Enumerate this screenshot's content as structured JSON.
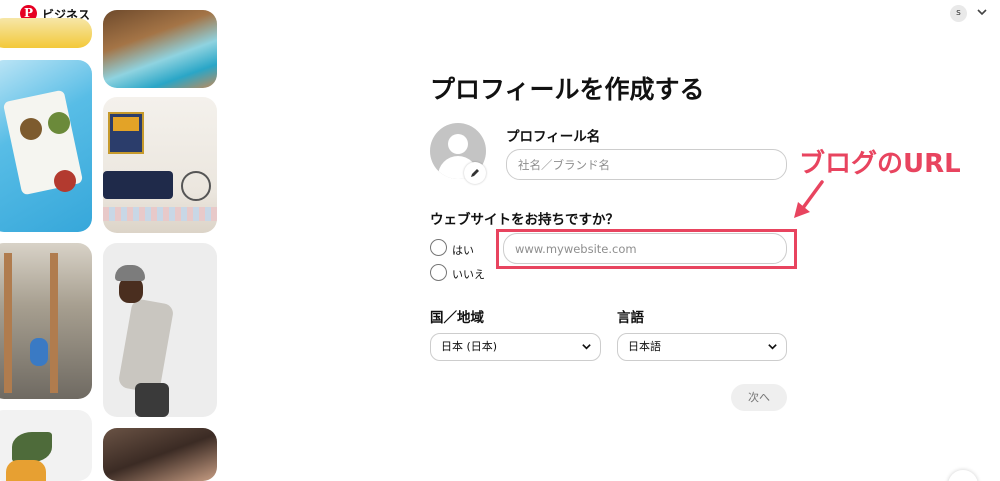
{
  "header": {
    "logo_glyph": "P",
    "brand": "ビジネス",
    "account_initial": "s"
  },
  "form": {
    "title": "プロフィールを作成する",
    "profile_name_label": "プロフィール名",
    "profile_name_placeholder": "社名／ブランド名",
    "website_question": "ウェブサイトをお持ちですか？",
    "option_yes": "はい",
    "option_no": "いいえ",
    "website_placeholder": "www.mywebsite.com",
    "country_label": "国／地域",
    "country_value": "日本 (日本)",
    "language_label": "言語",
    "language_value": "日本語",
    "next_button": "次へ"
  },
  "annotation": {
    "text": "ブログのURL",
    "color": "#e8445f"
  },
  "colors": {
    "brand_red": "#e60023",
    "annotation_pink": "#e8445f"
  },
  "icons": [
    "pinterest-logo-icon",
    "chevron-down-icon",
    "avatar-placeholder-icon",
    "pencil-icon",
    "arrow-icon"
  ]
}
